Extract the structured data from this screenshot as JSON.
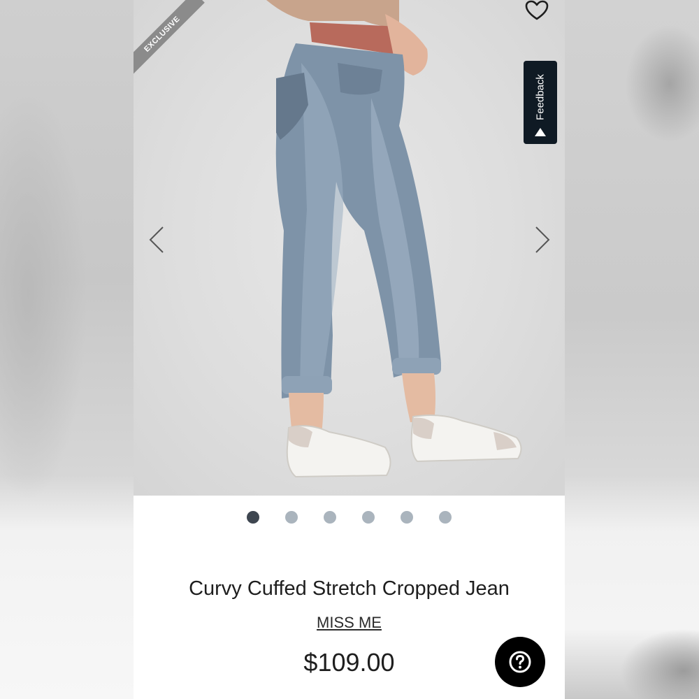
{
  "product": {
    "badge": "EXCLUSIVE",
    "title": "Curvy Cuffed Stretch Cropped Jean",
    "brand": "MISS ME",
    "price": "$109.00"
  },
  "feedback": {
    "label": "Feedback"
  },
  "carousel": {
    "total_slides": 6,
    "active_slide": 1
  },
  "icons": {
    "wishlist": "heart-outline-icon",
    "prev": "chevron-left-icon",
    "next": "chevron-right-icon",
    "feedback": "triangle-up-icon",
    "help": "question-mark-icon"
  },
  "colors": {
    "dot_active": "#3e4650",
    "dot_inactive": "#aab4bd",
    "feedback_bg": "#0f1a24",
    "ribbon_bg": "#8b8b8b"
  }
}
